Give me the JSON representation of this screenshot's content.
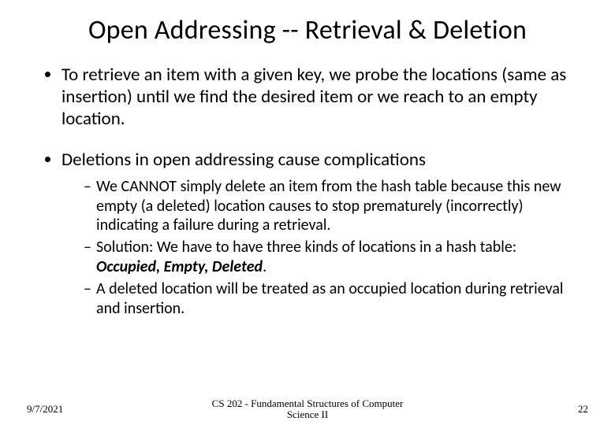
{
  "title": "Open Addressing -- Retrieval & Deletion",
  "bullets": {
    "b1": "To retrieve an item with a given key, we probe the locations (same as insertion) until we find the desired item or we reach to an empty location.",
    "b2": "Deletions in open addressing cause complications",
    "sub": {
      "s1": "We CANNOT simply delete an item from the hash table because this new empty (a deleted) location causes to stop prematurely (incorrectly) indicating a failure during a retrieval.",
      "s2a": "Solution: We have to have three kinds of locations in a hash table: ",
      "s2b": "Occupied, Empty, Deleted",
      "s2c": ".",
      "s3": "A deleted location will be treated as an occupied location during retrieval and insertion."
    }
  },
  "footer": {
    "date": "9/7/2021",
    "course": "CS 202 - Fundamental Structures of Computer Science II",
    "page": "22"
  }
}
